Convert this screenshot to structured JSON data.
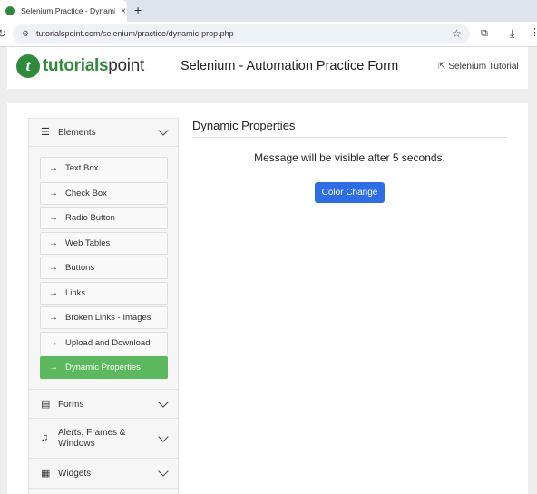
{
  "browser": {
    "tab_title": "Selenium Practice - Dynamic",
    "tab_close": "×",
    "new_tab": "+",
    "url": "tutorialspoint.com/selenium/practice/dynamic-prop.php"
  },
  "header": {
    "logo_prefix": "tutorials",
    "logo_suffix": "point",
    "title": "Selenium - Automation Practice Form",
    "link": "Selenium Tutorial"
  },
  "sidebar": {
    "elements_label": "Elements",
    "items": [
      {
        "label": "Text Box"
      },
      {
        "label": "Check Box"
      },
      {
        "label": "Radio Button"
      },
      {
        "label": "Web Tables"
      },
      {
        "label": "Buttons"
      },
      {
        "label": "Links"
      },
      {
        "label": "Broken Links - Images"
      },
      {
        "label": "Upload and Download"
      },
      {
        "label": "Dynamic Properties"
      }
    ],
    "forms_label": "Forms",
    "alerts_label": "Alerts, Frames & Windows",
    "widgets_label": "Widgets"
  },
  "content": {
    "title": "Dynamic Properties",
    "message": "Message will be visible after 5 seconds.",
    "button": "Color Change"
  },
  "colors": {
    "brand_green": "#2e8b3c",
    "active_item": "#5cb85c",
    "primary_button": "#2d6ee8"
  }
}
